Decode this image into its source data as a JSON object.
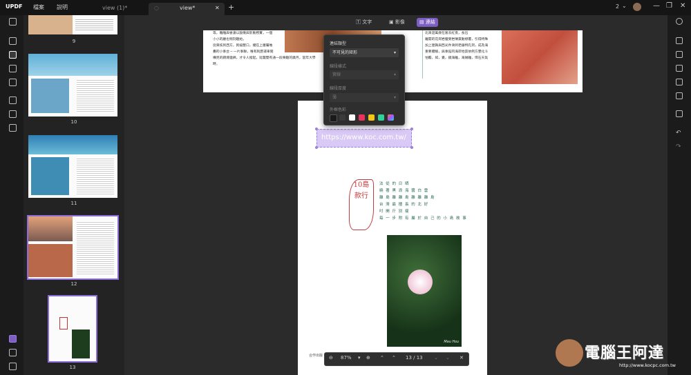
{
  "titlebar": {
    "logo": "UPDF",
    "menus": [
      "檔案",
      "說明"
    ],
    "tabs": [
      {
        "label": "view (1)*"
      },
      {
        "label": "view*"
      }
    ],
    "new_tab": "+",
    "page_count": "2",
    "minimize": "—",
    "restore": "❐",
    "close": "✕"
  },
  "thumbnails": [
    {
      "num": "9"
    },
    {
      "num": "10"
    },
    {
      "num": "11"
    },
    {
      "num": "12"
    },
    {
      "num": "13"
    }
  ],
  "toolbar": {
    "text_btn": "文字",
    "image_btn": "影像",
    "link_btn": "連結"
  },
  "link_panel": {
    "type_label": "連結類型",
    "type_value": "不可見的矩形",
    "style_label": "線段樣式",
    "style_value": "實線",
    "width_label": "線段厚度",
    "width_value": "薄",
    "color_label": "外框色彩",
    "swatches": [
      "#1a1a1a",
      "#3a3a3a",
      "#ffffff",
      "#e8345a",
      "#f5c518",
      "#2fd09a",
      "#9b59ff"
    ]
  },
  "document": {
    "link_text": "https://www.koc.com.tw/",
    "stamp_text": "10島 款行",
    "poem": [
      "法 從 的 日 晒",
      "曉 著 黑 浪 海 醬 白 雲",
      "離 島 離 離 島 離 離 離 島",
      "台 灣 最 擅 長 的 北 好",
      "吋 開 斤 別 瘦",
      "每 一 步 附 有 屬 於 自 己 的 小 島 故 事"
    ],
    "footer_left": "合作出版",
    "photo_credit": "Mau Hsu",
    "top_left_text": [
      "等，雕雕與會議以殷儀與影動務實，一個",
      "小小的廳也稍刻趣始，",
      "從東枝到西方，民繪雙口，擺在上層屬堆",
      "疊的小事台 ─ 一片事聯，唯有則歷運車閱",
      "構見的鋼煉連綿，才令人撥起，延襲雙有通一段樂趣的廣月，當年大學",
      "時，"
    ],
    "top_right_text": [
      "北來遊萬歲在富去紅夜，長石",
      "離開的花崗岩優受岩傳黨動標覆，引得特殊",
      "加上建縣與西光件滑到老銀特孔洞，成為海",
      "重要體驗，與事館的海岸地質依例方豐化斗",
      "怕瞻，如，覺，鏡海離，海賊離，悍石天氣"
    ]
  },
  "zoombar": {
    "zoom_out": "⊖",
    "zoom_value": "87%",
    "zoom_in": "⊕",
    "first": "⌃",
    "page_value": "13 / 13",
    "close": "✕"
  },
  "watermark": {
    "brand": "電腦王阿達",
    "url": "http://www.kocpc.com.tw"
  }
}
